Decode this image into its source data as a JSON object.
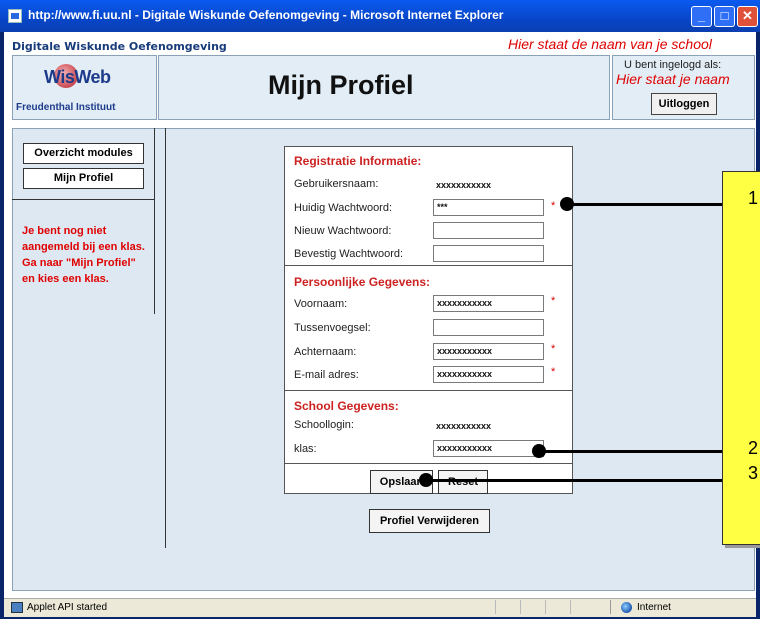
{
  "window": {
    "title": "http://www.fi.uu.nl - Digitale Wiskunde Oefenomgeving - Microsoft Internet Explorer",
    "minimize": "_",
    "maximize": "□",
    "close": "✕"
  },
  "header": {
    "app_label": "Digitale Wiskunde Oefenomgeving",
    "school_name": "Hier staat de naam van je school",
    "logo_text": "WisWeb",
    "logo_subtitle": "Freudenthal Instituut",
    "page_title": "Mijn Profiel",
    "login_label": "U bent ingelogd als:",
    "user_name": "Hier staat je naam",
    "logout_label": "Uitloggen"
  },
  "sidebar": {
    "items": [
      {
        "label": "Overzicht modules"
      },
      {
        "label": "Mijn Profiel"
      }
    ],
    "message": "Je bent nog niet aangemeld bij een klas. Ga naar \"Mijn Profiel\" en kies een klas."
  },
  "form": {
    "registration": {
      "heading": "Registratie Informatie:",
      "username_label": "Gebruikersnaam:",
      "username_value": "xxxxxxxxxxx",
      "current_pw_label": "Huidig Wachtwoord:",
      "current_pw_value": "***",
      "new_pw_label": "Nieuw Wachtwoord:",
      "new_pw_value": "",
      "confirm_pw_label": "Bevestig Wachtwoord:",
      "confirm_pw_value": ""
    },
    "personal": {
      "heading": "Persoonlijke Gegevens:",
      "firstname_label": "Voornaam:",
      "firstname_value": "xxxxxxxxxxx",
      "prefix_label": "Tussenvoegsel:",
      "prefix_value": "",
      "lastname_label": "Achternaam:",
      "lastname_value": "xxxxxxxxxxx",
      "email_label": "E-mail adres:",
      "email_value": "xxxxxxxxxxx"
    },
    "school": {
      "heading": "School Gegevens:",
      "schoollogin_label": "Schoollogin:",
      "schoollogin_value": "xxxxxxxxxxx",
      "class_label": "klas:",
      "class_value": "xxxxxxxxxxx"
    },
    "required_marker": "*",
    "save_label": "Opslaan",
    "reset_label": "Reset",
    "delete_label": "Profiel Verwijderen"
  },
  "annotations": {
    "numbers": [
      "1",
      "2",
      "3"
    ]
  },
  "statusbar": {
    "text": "Applet API started",
    "zone": "Internet"
  },
  "colors": {
    "titlebar": "#0846c9",
    "panel_bg": "#e2edf6",
    "red_text": "#e00000",
    "note_yellow": "#ffff44"
  }
}
